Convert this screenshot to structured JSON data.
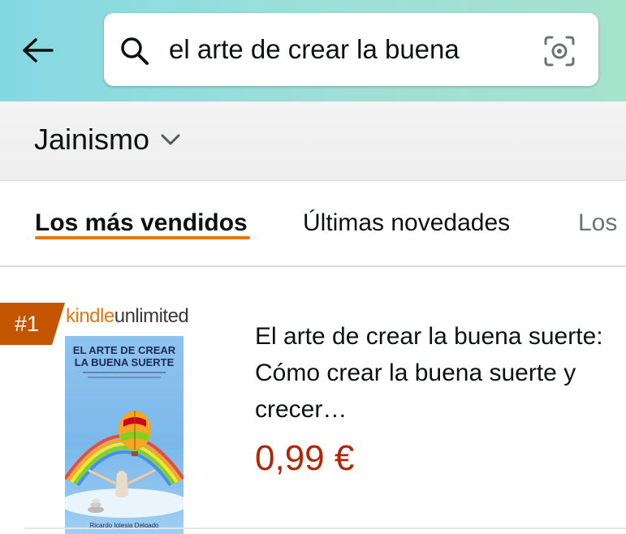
{
  "search": {
    "query": "el arte de crear la buena",
    "back_icon": "arrow-left-icon",
    "search_icon": "magnifier-icon",
    "camera_icon": "camera-lens-icon"
  },
  "department": {
    "label": "Jainismo",
    "icon": "chevron-down-icon"
  },
  "tabs": [
    {
      "label": "Los más vendidos",
      "active": true
    },
    {
      "label": "Últimas novedades",
      "active": false
    },
    {
      "label": "Los",
      "active": false
    }
  ],
  "product": {
    "rank": "#1",
    "badge_kindle": "kindle",
    "badge_unlimited": "unlimited",
    "cover_title_line1": "EL ARTE DE CREAR",
    "cover_title_line2": "LA BUENA SUERTE",
    "cover_author": "Ricardo Iglesia Delgado",
    "title": "El arte de crear la buena suerte: Cómo crear la buena suerte y crecer…",
    "price": "0,99 €"
  },
  "colors": {
    "accent": "#e47911",
    "badge": "#c45500",
    "price": "#b12704"
  }
}
